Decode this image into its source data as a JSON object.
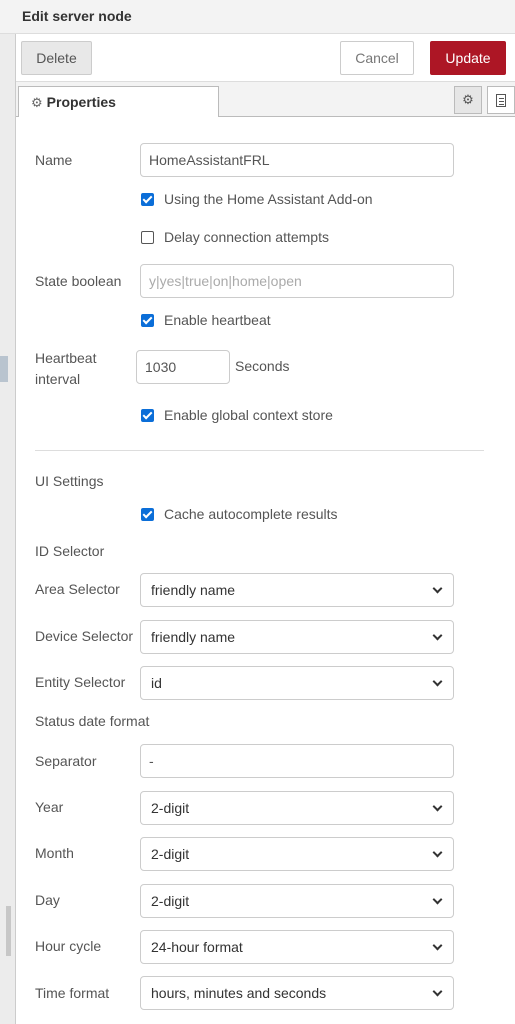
{
  "window": {
    "title": "Edit server node"
  },
  "toolbar": {
    "delete_label": "Delete",
    "cancel_label": "Cancel",
    "update_label": "Update"
  },
  "tabs": {
    "properties_label": "Properties"
  },
  "form": {
    "name_label": "Name",
    "name_value": "HomeAssistantFRL",
    "addon_label": "Using the Home Assistant Add-on",
    "addon_checked": true,
    "delay_label": "Delay connection attempts",
    "delay_checked": false,
    "state_boolean_label": "State boolean",
    "state_boolean_placeholder": "y|yes|true|on|home|open",
    "heartbeat_label": "Enable heartbeat",
    "heartbeat_checked": true,
    "heartbeat_interval_label_1": "Heartbeat",
    "heartbeat_interval_label_2": "interval",
    "heartbeat_interval_value": "1030",
    "seconds_label": "Seconds",
    "global_context_label": "Enable global context store",
    "global_context_checked": true,
    "ui_settings_label": "UI Settings",
    "cache_label": "Cache autocomplete results",
    "cache_checked": true,
    "id_selector_label": "ID Selector",
    "area_selector_label": "Area Selector",
    "area_selector_value": "friendly name",
    "device_selector_label": "Device Selector",
    "device_selector_value": "friendly name",
    "entity_selector_label": "Entity Selector",
    "entity_selector_value": "id",
    "status_date_format_label": "Status date format",
    "separator_label": "Separator",
    "separator_value": "-",
    "year_label": "Year",
    "year_value": "2-digit",
    "month_label": "Month",
    "month_value": "2-digit",
    "day_label": "Day",
    "day_value": "2-digit",
    "hour_cycle_label": "Hour cycle",
    "hour_cycle_value": "24-hour format",
    "time_format_label": "Time format",
    "time_format_value": "hours, minutes and seconds"
  },
  "colors": {
    "update_button": "#ad1625",
    "checkbox": "#0b6ed8"
  }
}
